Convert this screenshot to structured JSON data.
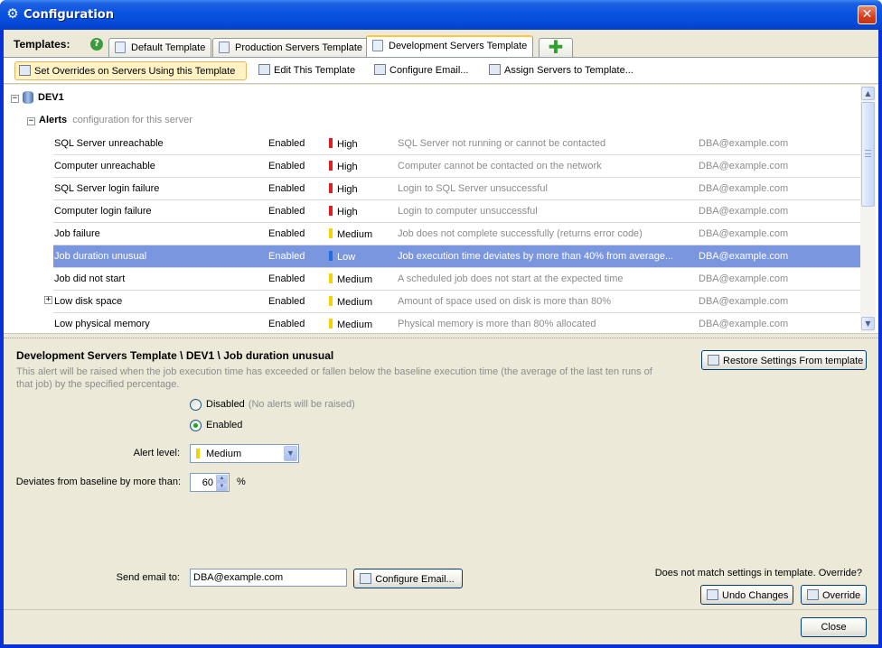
{
  "window": {
    "title": "Configuration",
    "close_glyph": "✕",
    "icon": "gear-icon"
  },
  "templates": {
    "label": "Templates:",
    "help_glyph": "?",
    "tabs": [
      {
        "label": "Default Template"
      },
      {
        "label": "Production Servers Template"
      },
      {
        "label": "Development Servers Template"
      }
    ],
    "add_glyph": "✚"
  },
  "toolbar": {
    "set_overrides": "Set Overrides on Servers Using this Template",
    "edit": "Edit This Template",
    "configure_email": "Configure Email...",
    "assign": "Assign Servers to Template..."
  },
  "tree": {
    "server": "DEV1",
    "alerts_label": "Alerts",
    "alerts_hint": "configuration for this server",
    "rows": [
      {
        "name": "SQL Server unreachable",
        "status": "Enabled",
        "level": "High",
        "level_color": "#e02020",
        "desc": "SQL Server not running or cannot be contacted",
        "email": "DBA@example.com"
      },
      {
        "name": "Computer unreachable",
        "status": "Enabled",
        "level": "High",
        "level_color": "#e02020",
        "desc": "Computer cannot be contacted on the network",
        "email": "DBA@example.com"
      },
      {
        "name": "SQL Server login failure",
        "status": "Enabled",
        "level": "High",
        "level_color": "#e02020",
        "desc": "Login to SQL Server unsuccessful",
        "email": "DBA@example.com"
      },
      {
        "name": "Computer login failure",
        "status": "Enabled",
        "level": "High",
        "level_color": "#e02020",
        "desc": "Login to computer unsuccessful",
        "email": "DBA@example.com"
      },
      {
        "name": "Job failure",
        "status": "Enabled",
        "level": "Medium",
        "level_color": "#f5d300",
        "desc": "Job does not complete successfully (returns error code)",
        "email": "DBA@example.com"
      },
      {
        "name": "Job duration unusual",
        "status": "Enabled",
        "level": "Low",
        "level_color": "#1e6fe0",
        "desc": "Job execution time deviates by more than 40% from average...",
        "email": "DBA@example.com"
      },
      {
        "name": "Job did not start",
        "status": "Enabled",
        "level": "Medium",
        "level_color": "#f5d300",
        "desc": "A scheduled  job does not start at the expected time",
        "email": "DBA@example.com"
      },
      {
        "name": "Low disk space",
        "status": "Enabled",
        "level": "Medium",
        "level_color": "#f5d300",
        "desc": "Amount of space used on disk is more than 80%",
        "email": "DBA@example.com"
      },
      {
        "name": "Low physical memory",
        "status": "Enabled",
        "level": "Medium",
        "level_color": "#f5d300",
        "desc": "Physical memory is more than 80% allocated",
        "email": "DBA@example.com"
      }
    ]
  },
  "details": {
    "path": "Development Servers Template \\ DEV1 \\ Job duration unusual",
    "description": "This alert will be raised when the job execution time has exceeded or fallen below the baseline execution time (the average of the last ten runs of that job) by the specified percentage.",
    "restore_button": "Restore Settings From template",
    "disabled_label": "Disabled",
    "disabled_hint": "(No alerts will be raised)",
    "enabled_label": "Enabled",
    "alert_level_label": "Alert level:",
    "alert_level_value": "Medium",
    "deviates_label": "Deviates from baseline by more than:",
    "deviates_value": "60",
    "deviates_unit": "%",
    "send_email_label": "Send email to:",
    "send_email_value": "DBA@example.com",
    "configure_email_button": "Configure Email...",
    "mismatch_text": "Does not match settings in template. Override?",
    "undo_button": "Undo Changes",
    "override_button": "Override"
  },
  "footer": {
    "close_button": "Close"
  }
}
